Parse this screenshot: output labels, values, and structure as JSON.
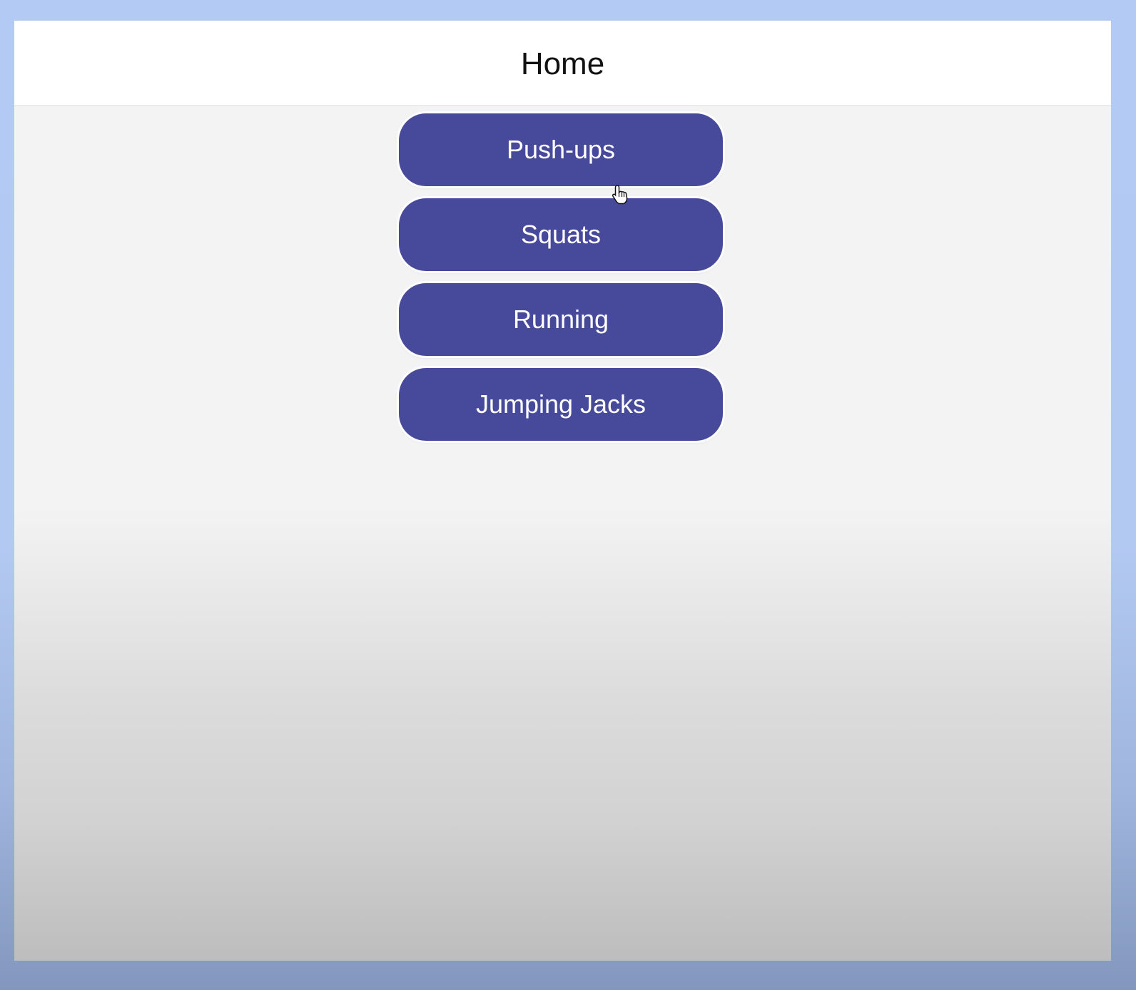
{
  "header": {
    "title": "Home"
  },
  "exercises": [
    {
      "label": "Push-ups"
    },
    {
      "label": "Squats"
    },
    {
      "label": "Running"
    },
    {
      "label": "Jumping Jacks"
    }
  ],
  "colors": {
    "button_bg": "#474a9b",
    "button_text": "#ffffff",
    "header_bg": "#ffffff",
    "content_bg": "#f3f3f3",
    "desktop_bg": "#b3cbf4"
  },
  "cursor": {
    "icon": "hand-pointer-icon"
  }
}
